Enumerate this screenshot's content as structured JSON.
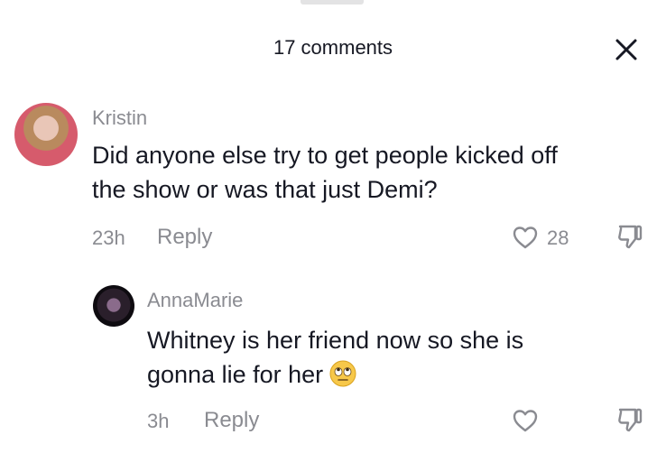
{
  "header": {
    "title": "17 comments",
    "close_icon": "close-icon"
  },
  "comments": [
    {
      "username": "Kristin",
      "text_line1": "Did anyone else try to get people kicked off",
      "text_line2": "the show or was that just Demi?",
      "time": "23h",
      "reply_label": "Reply",
      "likes": "28"
    },
    {
      "username": "AnnaMarie",
      "text_line1": "Whitney is her friend now so she is",
      "text_line2": "gonna lie for her",
      "emoji": "eye-roll-emoji",
      "time": "3h",
      "reply_label": "Reply",
      "likes": ""
    }
  ]
}
